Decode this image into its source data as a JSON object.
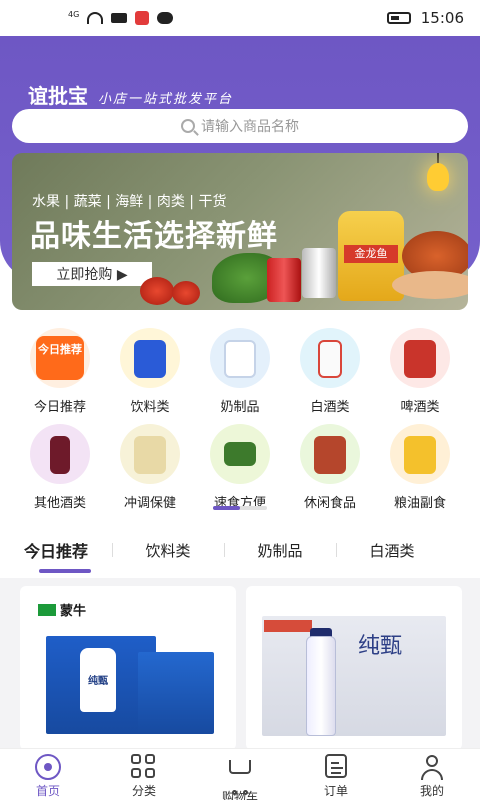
{
  "status_bar": {
    "network": "4G",
    "time": "15:06"
  },
  "header": {
    "brand_name": "谊批宝",
    "slogan": "小店一站式批发平台",
    "search_placeholder": "请输入商品名称"
  },
  "banner": {
    "categories": "水果 | 蔬菜 | 海鲜 | 肉类 | 干货",
    "title": "品味生活选择新鲜",
    "button_label": "立即抢购 ▶",
    "oil_label": "金龙鱼"
  },
  "categories": [
    {
      "label": "今日推荐",
      "icon_text": "今日推荐",
      "color": "#ff6a1a",
      "bg": "#ffefe0"
    },
    {
      "label": "饮料类",
      "color": "#2a5bd7",
      "bg": "#fff6d8"
    },
    {
      "label": "奶制品",
      "color": "#dfe8f5",
      "bg": "#e4f0fb"
    },
    {
      "label": "白酒类",
      "color": "#f6f6f6",
      "bg": "#e1f4fb"
    },
    {
      "label": "啤酒类",
      "color": "#c9342b",
      "bg": "#fde8e6"
    },
    {
      "label": "其他酒类",
      "color": "#6e1a2a",
      "bg": "#f3e3f5"
    },
    {
      "label": "冲调保健",
      "color": "#e8d9a6",
      "bg": "#f7f2d8"
    },
    {
      "label": "速食方便",
      "color": "#3d7a2c",
      "bg": "#edf7d8"
    },
    {
      "label": "休闲食品",
      "color": "#b5462c",
      "bg": "#eaf7dc"
    },
    {
      "label": "粮油副食",
      "color": "#f4c12c",
      "bg": "#fff0d6"
    }
  ],
  "tabs": [
    {
      "label": "今日推荐",
      "active": true
    },
    {
      "label": "饮料类"
    },
    {
      "label": "奶制品"
    },
    {
      "label": "白酒类"
    }
  ],
  "products": [
    {
      "brand": "蒙牛",
      "name": "纯甄"
    },
    {
      "brand": "",
      "name": "纯甄"
    }
  ],
  "bottom_nav": [
    {
      "label": "首页",
      "icon": "home-icon",
      "active": true
    },
    {
      "label": "分类",
      "icon": "grid-icon"
    },
    {
      "label": "购物车",
      "icon": "cart-icon"
    },
    {
      "label": "订单",
      "icon": "order-icon"
    },
    {
      "label": "我的",
      "icon": "user-icon"
    }
  ],
  "colors": {
    "primary": "#6e57c4"
  }
}
